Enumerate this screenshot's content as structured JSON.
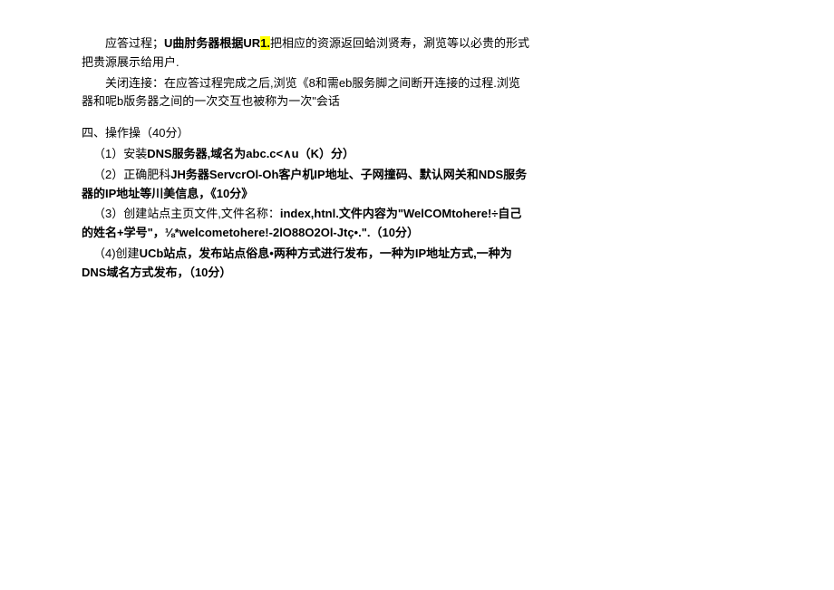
{
  "paragraphs": {
    "p1_pre": "应答过程；",
    "p1_bold1": "U曲肘务器根据UR",
    "p1_hl": "1.",
    "p1_post": "把相应的资源返回蛤浏贤寿，涮览等以必贵的形式把贵源展示给用户.",
    "p2": "关闭连接：在应答过程完成之后,浏览《8和需eb服务脚之间断开连接的过程.浏览器和呢b版务器之间的一次交互也被称为一次\"会话",
    "p3": "四、操作操（40分）",
    "p4_a": "（1）安装",
    "p4_b": "DNS服务器,域名为abc.c<∧u（K）分）",
    "p5_a": "（2）正确肥科",
    "p5_b": "JH务器ServcrOl-Oh客户机IP地址、子网撞码、默认网关和NDS服务器的IP地址等川美信息，《10分》",
    "p6_a": "（3）创建站点主页文件,文件名称：",
    "p6_b": "index,htnl.文件内容为\"WelCOMtohere!÷自己的姓名+学号\"，⅛*welcometohere!-2lO88O2Ol-Jtç•.\".（10分）",
    "p7_a": "（4)创建",
    "p7_b": "UCb站点，发布站点俗息•两种方式进行发布，一种为IP地址方式,一种为DNS域名方式发布，（10分）"
  }
}
